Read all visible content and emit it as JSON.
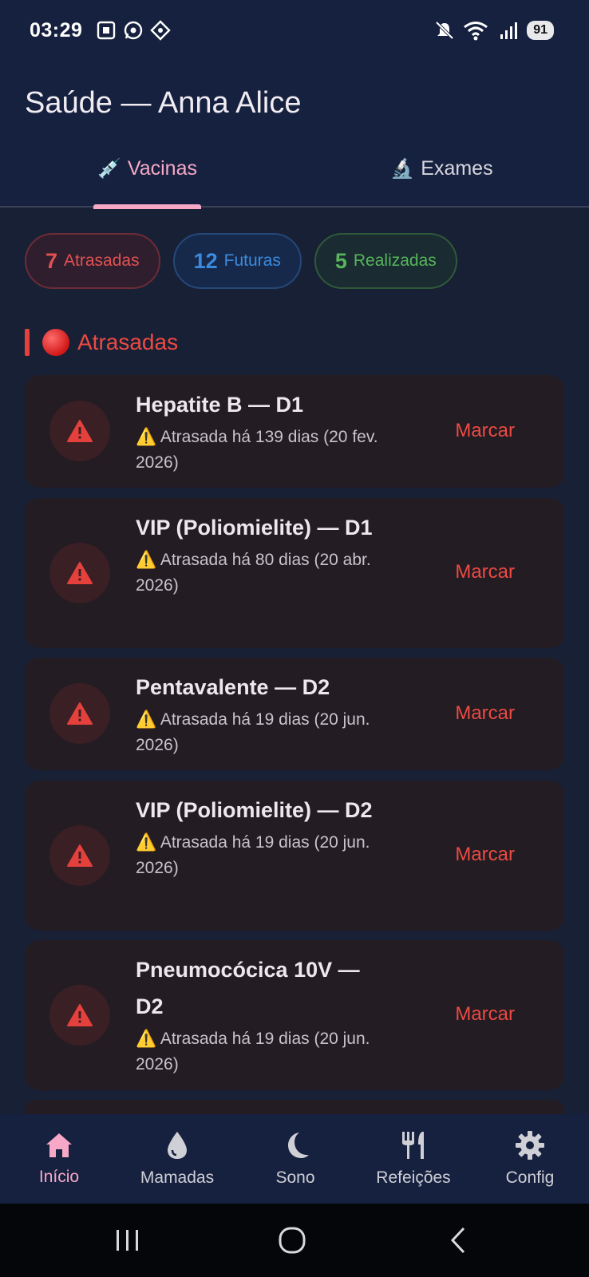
{
  "status": {
    "time": "03:29",
    "battery": "91"
  },
  "app": {
    "title": "Saúde — Anna Alice"
  },
  "tabs": [
    {
      "emoji": "💉",
      "label": "Vacinas"
    },
    {
      "emoji": "🔬",
      "label": "Exames"
    }
  ],
  "summary": {
    "overdue": {
      "count": "7",
      "label": "Atrasadas"
    },
    "future": {
      "count": "12",
      "label": "Futuras"
    },
    "done": {
      "count": "5",
      "label": "Realizadas"
    }
  },
  "section": {
    "title": "Atrasadas"
  },
  "cards": [
    {
      "title": "Hepatite B — D1",
      "sub": "⚠️ Atrasada há 139 dias (20 fev. 2026)",
      "action": "Marcar"
    },
    {
      "title": "VIP (Poliomielite) — D1",
      "sub": "⚠️ Atrasada há 80 dias (20 abr. 2026)",
      "action": "Marcar"
    },
    {
      "title": "Pentavalente — D2",
      "sub": "⚠️ Atrasada há 19 dias (20 jun. 2026)",
      "action": "Marcar"
    },
    {
      "title": "VIP (Poliomielite) — D2",
      "sub": "⚠️ Atrasada há 19 dias (20 jun. 2026)",
      "action": "Marcar"
    },
    {
      "title": "Pneumocócica 10V — D2",
      "sub": "⚠️ Atrasada há 19 dias (20 jun. 2026)",
      "action": "Marcar"
    }
  ],
  "bottom_nav": [
    {
      "label": "Início",
      "icon": "home-icon",
      "active": true
    },
    {
      "label": "Mamadas",
      "icon": "drop-icon"
    },
    {
      "label": "Sono",
      "icon": "moon-icon"
    },
    {
      "label": "Refeições",
      "icon": "fork-knife-icon"
    },
    {
      "label": "Config",
      "icon": "gear-icon"
    }
  ],
  "colors": {
    "accent": "#f7a8c7",
    "danger": "#ee4a42",
    "future": "#3a8be0",
    "done": "#57b45c",
    "background": "#182036"
  }
}
